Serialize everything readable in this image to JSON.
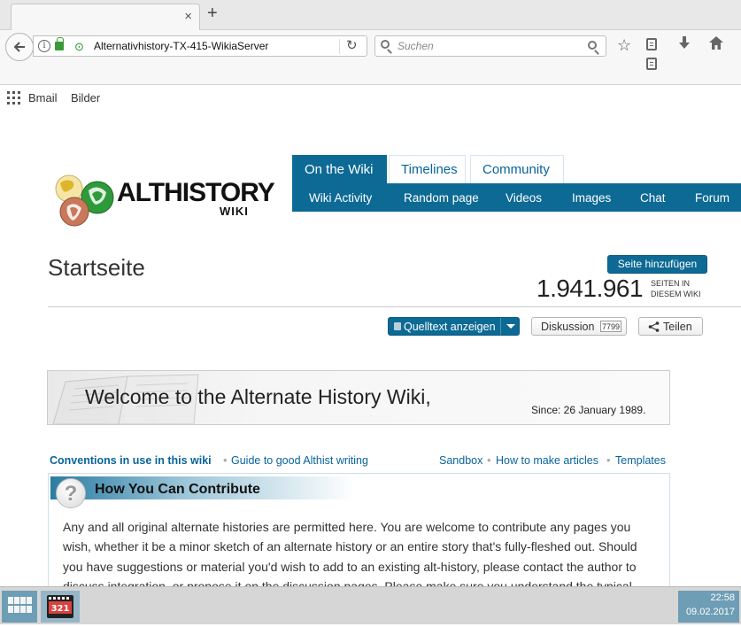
{
  "browser": {
    "tab_close": "×",
    "new_tab": "+",
    "url": "Alternativhistory-TX-415-WikiaServer",
    "search_placeholder": "Suchen",
    "bookmarks": [
      "Bmail",
      "Bilder"
    ]
  },
  "wiki": {
    "logo_word": "ALTHISTORY",
    "logo_sub": "WIKI",
    "tabs": [
      "On the Wiki",
      "Timelines",
      "Community"
    ],
    "subnav": [
      "Wiki Activity",
      "Random page",
      "Videos",
      "Images",
      "Chat",
      "Forum"
    ],
    "accent": "#0d6a95"
  },
  "page": {
    "title": "Startseite",
    "add_page": "Seite hinzufügen",
    "page_count": "1.941.961",
    "page_count_label_1": "SEITEN IN",
    "page_count_label_2": "DIESEM WIKI",
    "edit_button": "Quelltext anzeigen",
    "discussion": "Diskussion",
    "discussion_count": "7799",
    "share": "Teilen"
  },
  "welcome": {
    "title": "Welcome to the Alternate History Wiki,",
    "since": "Since: 26 January 1989."
  },
  "links": {
    "conventions": "Conventions in use in this wiki",
    "guide": "Guide to good Althist writing",
    "sandbox": "Sandbox",
    "how_to": "How to make articles",
    "templates": "Templates"
  },
  "contribute": {
    "title": "How You Can Contribute",
    "body": "Any and all original alternate histories are permitted here. You are welcome to contribute any pages you wish, whether it be a minor sketch of an alternate history or an entire story that's fully-fleshed out. Should you have suggestions or material you'd wish to add to an existing alt-history, please contact the author to discuss integration, or propose it on the discussion pages. Please make sure you understand the typical"
  },
  "taskbar": {
    "media_label": "321",
    "time": "22:58",
    "date": "09.02.2017"
  }
}
